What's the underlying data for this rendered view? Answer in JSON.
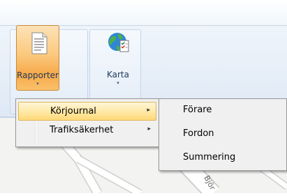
{
  "ribbon": {
    "buttons": [
      {
        "label": "Rapporter",
        "arrow": "▾",
        "icon": "document-icon"
      },
      {
        "label": "Karta",
        "arrow": "▾",
        "icon": "globe-checklist-icon"
      }
    ]
  },
  "menu": {
    "items": [
      {
        "label": "Körjournal",
        "arrow": "▸",
        "highlighted": true
      },
      {
        "label": "Trafiksäkerhet",
        "arrow": "▸",
        "highlighted": false
      }
    ]
  },
  "submenu": {
    "items": [
      {
        "label": "Förare"
      },
      {
        "label": "Fordon"
      },
      {
        "label": "Summering"
      }
    ]
  },
  "map": {
    "street_label": "Björ"
  },
  "colors": {
    "highlight_orange": "#f7a94a",
    "menu_highlight": "#ffe9a8",
    "ribbon_blue": "#dfe9f5",
    "text_blue": "#1e395b"
  }
}
